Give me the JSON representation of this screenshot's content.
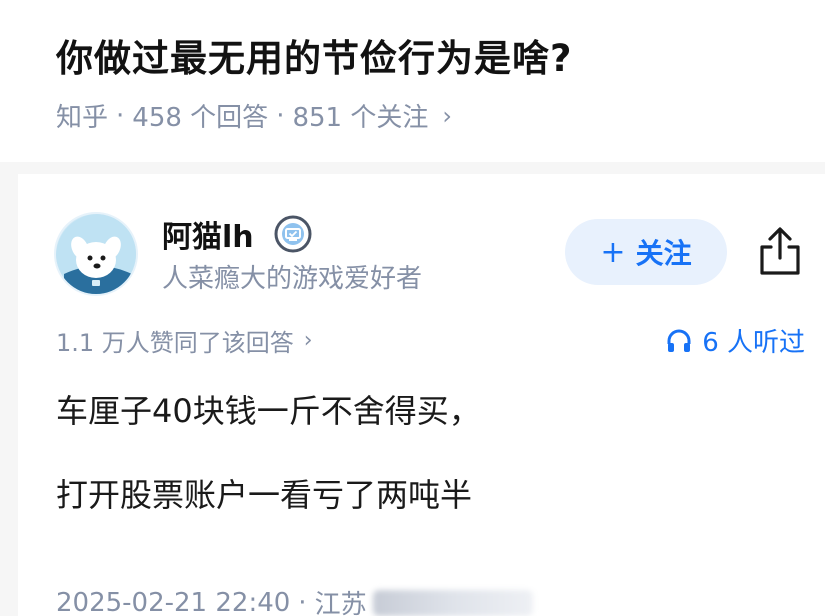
{
  "question": {
    "title": "你做过最无用的节俭行为是啥?",
    "source": "知乎",
    "answers_count": "458 个回答",
    "followers_count": "851 个关注",
    "separator": "·",
    "chevron": "›"
  },
  "author": {
    "name": "阿猫lh",
    "bio": "人菜瘾大的游戏爱好者",
    "avatar_icon": "dog-avatar-icon",
    "badge_icon": "verified-badge-icon",
    "follow_plus": "+",
    "follow_label": "关注",
    "share_icon": "share-icon"
  },
  "stats": {
    "votes_text": "1.1 万人赞同了该回答",
    "chevron": "›",
    "listen_icon": "headphones-icon",
    "listen_text": "6 人听过"
  },
  "answer": {
    "paragraphs": [
      "车厘子40块钱一斤不舍得买，",
      "打开股票账户一看亏了两吨半"
    ]
  },
  "footer": {
    "datetime": "2025-02-21 22:40",
    "separator": "·",
    "location_partial": "江苏"
  },
  "colors": {
    "accent": "#1772f6",
    "accent_bg": "#e8f1fd",
    "meta_gray": "#8590a6",
    "title": "#121212"
  }
}
